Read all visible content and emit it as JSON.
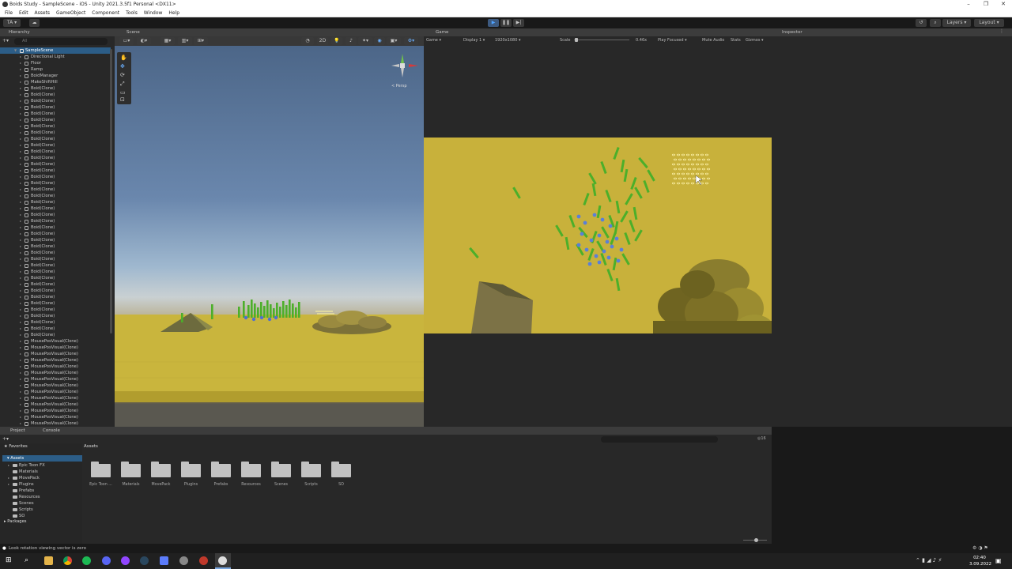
{
  "window": {
    "title": "Boids Study - SampleScene - iOS - Unity 2021.3.5f1 Personal <DX11>"
  },
  "menu": [
    "File",
    "Edit",
    "Assets",
    "GameObject",
    "Component",
    "Tools",
    "Window",
    "Help"
  ],
  "toolbar": {
    "account": "TA",
    "layers_label": "Layers",
    "layout_label": "Layout"
  },
  "hierarchy": {
    "tab_label": "Hierarchy",
    "search_placeholder": "All",
    "scene_name": "SampleScene",
    "root_items": [
      "Directional Light",
      "Floor",
      "Ramp",
      "BoidManager",
      "MakeShiftHill"
    ],
    "boid_clone_label": "Boid(Clone)",
    "boid_clone_count": 40,
    "mouse_clone_label": "MousePosVisual(Clone)",
    "mouse_clone_count": 14
  },
  "scene": {
    "tab_label": "Scene",
    "persp_label": "< Persp"
  },
  "game": {
    "tab_label": "Game",
    "mode": "Game",
    "display": "Display 1",
    "resolution": "1920x1080",
    "scale_label": "Scale",
    "scale_value": "0.46x",
    "play_mode": "Play Focused",
    "mute_label": "Mute Audio",
    "stats_label": "Stats",
    "gizmos_label": "Gizmos"
  },
  "inspector": {
    "tab_label": "Inspector"
  },
  "project": {
    "tabs": [
      "Project",
      "Console"
    ],
    "favorites_label": "Favorites",
    "assets_label": "Assets",
    "tree": [
      "Epic Toon FX",
      "Materials",
      "MovePack",
      "Plugins",
      "Prefabs",
      "Resources",
      "Scenes",
      "Scripts",
      "SO"
    ],
    "packages_label": "Packages",
    "breadcrumb": "Assets",
    "folders": [
      "Epic Toon ...",
      "Materials",
      "MovePack",
      "Plugins",
      "Prefabs",
      "Resources",
      "Scenes",
      "Scripts",
      "SO"
    ],
    "count_badge": "16"
  },
  "status": {
    "message": "Look rotation viewing vector is zero"
  },
  "taskbar": {
    "time": "02:40",
    "date": "3.09.2022"
  },
  "colors": {
    "play_accent": "#4fa3ff",
    "ground": "#c8b13b",
    "boid_green": "#4caf2a",
    "selection": "#2c5d87"
  }
}
